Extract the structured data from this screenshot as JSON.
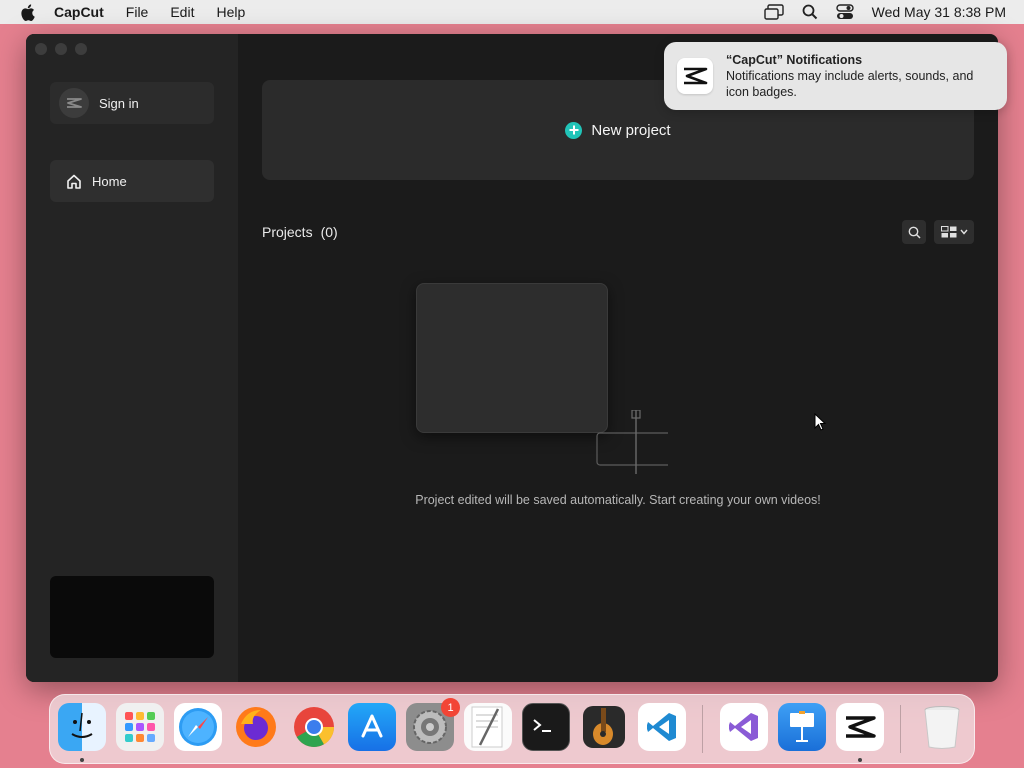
{
  "menubar": {
    "app_name": "CapCut",
    "items": [
      "File",
      "Edit",
      "Help"
    ],
    "datetime": "Wed May 31  8:38 PM"
  },
  "sidebar": {
    "sign_in_label": "Sign in",
    "home_label": "Home"
  },
  "main": {
    "new_project_label": "New project",
    "projects_label": "Projects",
    "projects_count": "(0)",
    "empty_message": "Project edited will be saved automatically. Start creating your own videos!"
  },
  "notification": {
    "title": "“CapCut” Notifications",
    "body": "Notifications may include alerts, sounds, and icon badges."
  },
  "dock": {
    "apps": [
      "Finder",
      "Launchpad",
      "Safari",
      "Firefox",
      "Chrome",
      "App Store",
      "System Settings",
      "TextEdit",
      "Terminal",
      "GarageBand",
      "Visual Studio Code",
      "Visual Studio",
      "Keynote",
      "CapCut",
      "Trash"
    ],
    "settings_badge": "1"
  },
  "colors": {
    "accent": "#21c4b8",
    "desktop": "#e5808f",
    "window_bg": "#1b1b1b"
  }
}
